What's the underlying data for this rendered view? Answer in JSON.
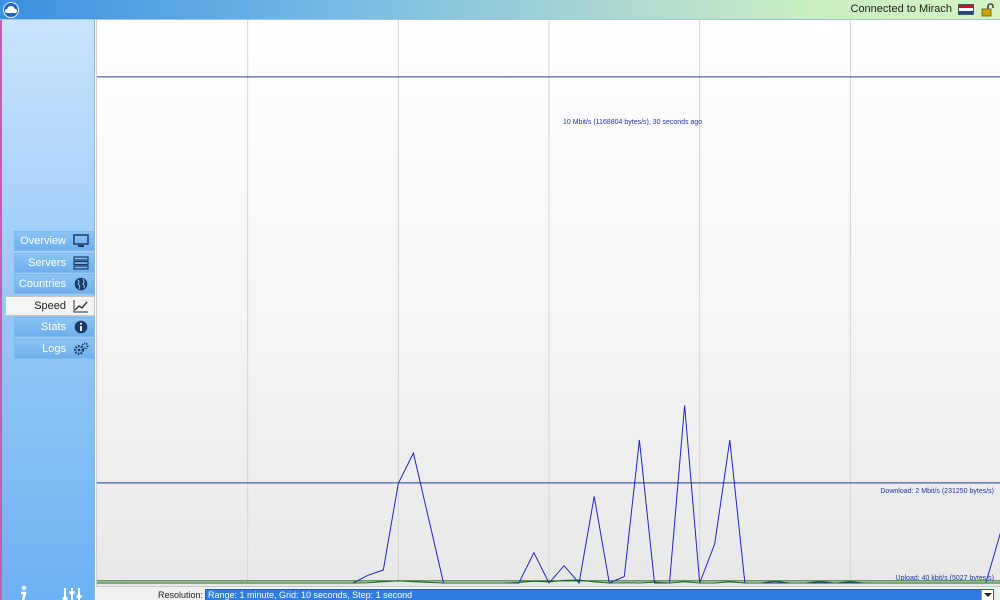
{
  "titlebar": {
    "status_text": "Connected to Mirach",
    "flag": [
      "#c8102e",
      "#ffffff",
      "#21468b"
    ],
    "icons": [
      "cloud-logo-icon",
      "netherlands-flag-icon",
      "unlock-icon"
    ]
  },
  "sidebar": {
    "items": [
      {
        "label": "Overview",
        "icon": "monitor-icon",
        "active": false
      },
      {
        "label": "Servers",
        "icon": "servers-icon",
        "active": false
      },
      {
        "label": "Countries",
        "icon": "globe-icon",
        "active": false
      },
      {
        "label": "Speed",
        "icon": "chart-icon",
        "active": true
      },
      {
        "label": "Stats",
        "icon": "info-circle-icon",
        "active": false
      },
      {
        "label": "Logs",
        "icon": "gears-icon",
        "active": false
      }
    ],
    "footer_icons": [
      "info-icon",
      "mixer-icon"
    ]
  },
  "graph": {
    "peak_label": "10 Mbit/s (1168804 bytes/s), 30 seconds ago",
    "download_label": "Download: 2 Mbit/s (231250 bytes/s)",
    "upload_label": "Upload: 40 kbit/s (5027 bytes/s)",
    "colors": {
      "download": "#2222cc",
      "upload": "#116611",
      "reference": "#1f3f8f",
      "grid": "#d4d4d4"
    }
  },
  "chart_data": {
    "type": "line",
    "x_range_seconds": [
      0,
      60
    ],
    "grid_step_seconds": 10,
    "ylim_bytes_per_s": [
      0,
      1300000
    ],
    "series": [
      {
        "name": "Download",
        "values": [
          0,
          0,
          0,
          0,
          0,
          0,
          0,
          0,
          0,
          0,
          0,
          0,
          0,
          0,
          0,
          0,
          0,
          0,
          18000,
          30000,
          230000,
          300000,
          150000,
          0,
          0,
          0,
          0,
          0,
          0,
          70000,
          0,
          40000,
          0,
          200000,
          0,
          15000,
          330000,
          0,
          0,
          410000,
          0,
          90000,
          330000,
          0,
          0,
          0,
          0,
          0,
          0,
          0,
          0,
          0,
          0,
          0,
          0,
          0,
          0,
          0,
          0,
          0,
          120000
        ]
      },
      {
        "name": "Upload",
        "values": [
          0,
          0,
          0,
          0,
          0,
          0,
          0,
          0,
          0,
          0,
          0,
          0,
          0,
          0,
          0,
          0,
          0,
          0,
          800,
          3000,
          5000,
          3000,
          1500,
          0,
          0,
          0,
          0,
          0,
          1500,
          4000,
          2500,
          6000,
          7000,
          2500,
          0,
          800,
          0,
          2000,
          0,
          3000,
          0,
          0,
          2500,
          0,
          0,
          3500,
          0,
          0,
          3000,
          0,
          2500,
          0,
          0,
          0,
          0,
          0,
          0,
          0,
          0,
          0,
          0
        ]
      }
    ],
    "reference_lines": [
      {
        "label": "10 Mbit/s (1168804 bytes/s), 30 seconds ago",
        "value": 1168804
      },
      {
        "label": "Download: 2 Mbit/s (231250 bytes/s)",
        "value": 231250
      },
      {
        "label": "Upload: 40 kbit/s (5027 bytes/s)",
        "value": 5027
      }
    ],
    "grid": true
  },
  "bottombar": {
    "resolution_label": "Resolution:",
    "resolution_value": "Range: 1 minute, Grid: 10 seconds, Step: 1 second"
  }
}
